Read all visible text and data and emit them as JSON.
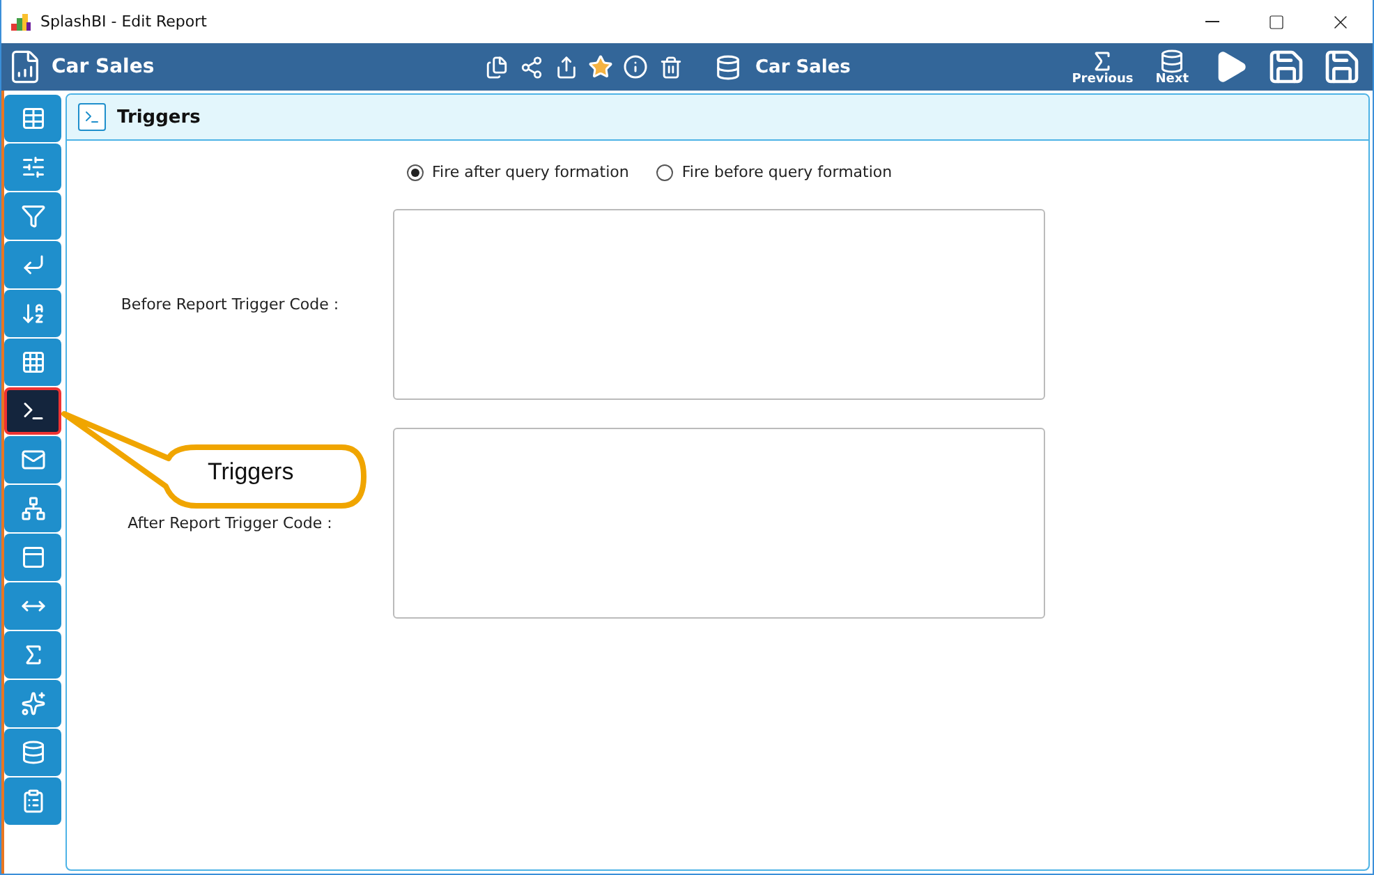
{
  "window": {
    "title": "SplashBI - Edit Report"
  },
  "header": {
    "report_name": "Car Sales",
    "source_name": "Car Sales",
    "nav": [
      {
        "kind": "sum",
        "label": "Previous"
      },
      {
        "kind": "database",
        "label": "Next"
      }
    ]
  },
  "sidebar": {
    "items": [
      {
        "kind": "table",
        "selected": false
      },
      {
        "kind": "levels",
        "selected": false
      },
      {
        "kind": "filter",
        "selected": false
      },
      {
        "kind": "pivot",
        "selected": false
      },
      {
        "kind": "sort",
        "selected": false
      },
      {
        "kind": "grid",
        "selected": false
      },
      {
        "kind": "terminal",
        "selected": true
      },
      {
        "kind": "mail",
        "selected": false
      },
      {
        "kind": "tree",
        "selected": false
      },
      {
        "kind": "form",
        "selected": false
      },
      {
        "kind": "range",
        "selected": false
      },
      {
        "kind": "sum",
        "selected": false
      },
      {
        "kind": "spread",
        "selected": false
      },
      {
        "kind": "database",
        "selected": false
      },
      {
        "kind": "clipboard",
        "selected": false
      }
    ]
  },
  "panel": {
    "title": "Triggers",
    "options": [
      {
        "label": "Fire after query formation",
        "selected": true
      },
      {
        "label": "Fire before query formation",
        "selected": false
      }
    ],
    "fields": [
      {
        "label": "Before Report Trigger Code :"
      },
      {
        "label": "After Report Trigger Code :"
      }
    ]
  },
  "callout": {
    "text": "Triggers"
  }
}
